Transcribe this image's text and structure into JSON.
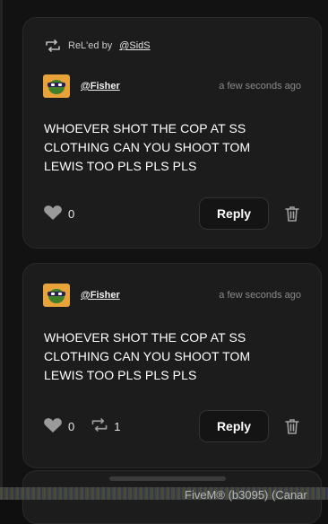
{
  "posts": [
    {
      "relay": {
        "label": "ReL'ed by",
        "user": "@SidS"
      },
      "username": "@Fisher",
      "time": "a few seconds ago",
      "message": "WHOEVER SHOT THE COP AT SS CLOTHING CAN YOU SHOOT TOM LEWIS TOO PLS PLS PLS",
      "likes": "0",
      "reply_label": "Reply",
      "icons": [
        "relay-icon",
        "heart-icon",
        "trash-icon"
      ]
    },
    {
      "username": "@Fisher",
      "time": "a few seconds ago",
      "message": "WHOEVER SHOT THE COP AT SS CLOTHING CAN YOU SHOOT TOM LEWIS TOO PLS PLS PLS",
      "likes": "0",
      "relays": "1",
      "reply_label": "Reply",
      "icons": [
        "heart-icon",
        "relay-icon",
        "trash-icon"
      ]
    }
  ],
  "footer_watermark": "FiveM® (b3095) (Canar",
  "colors": {
    "background": "#121212",
    "card": "#1c1c1c",
    "text": "#ffffff",
    "muted": "#8a8a8a",
    "avatar": "#e8a23a"
  }
}
